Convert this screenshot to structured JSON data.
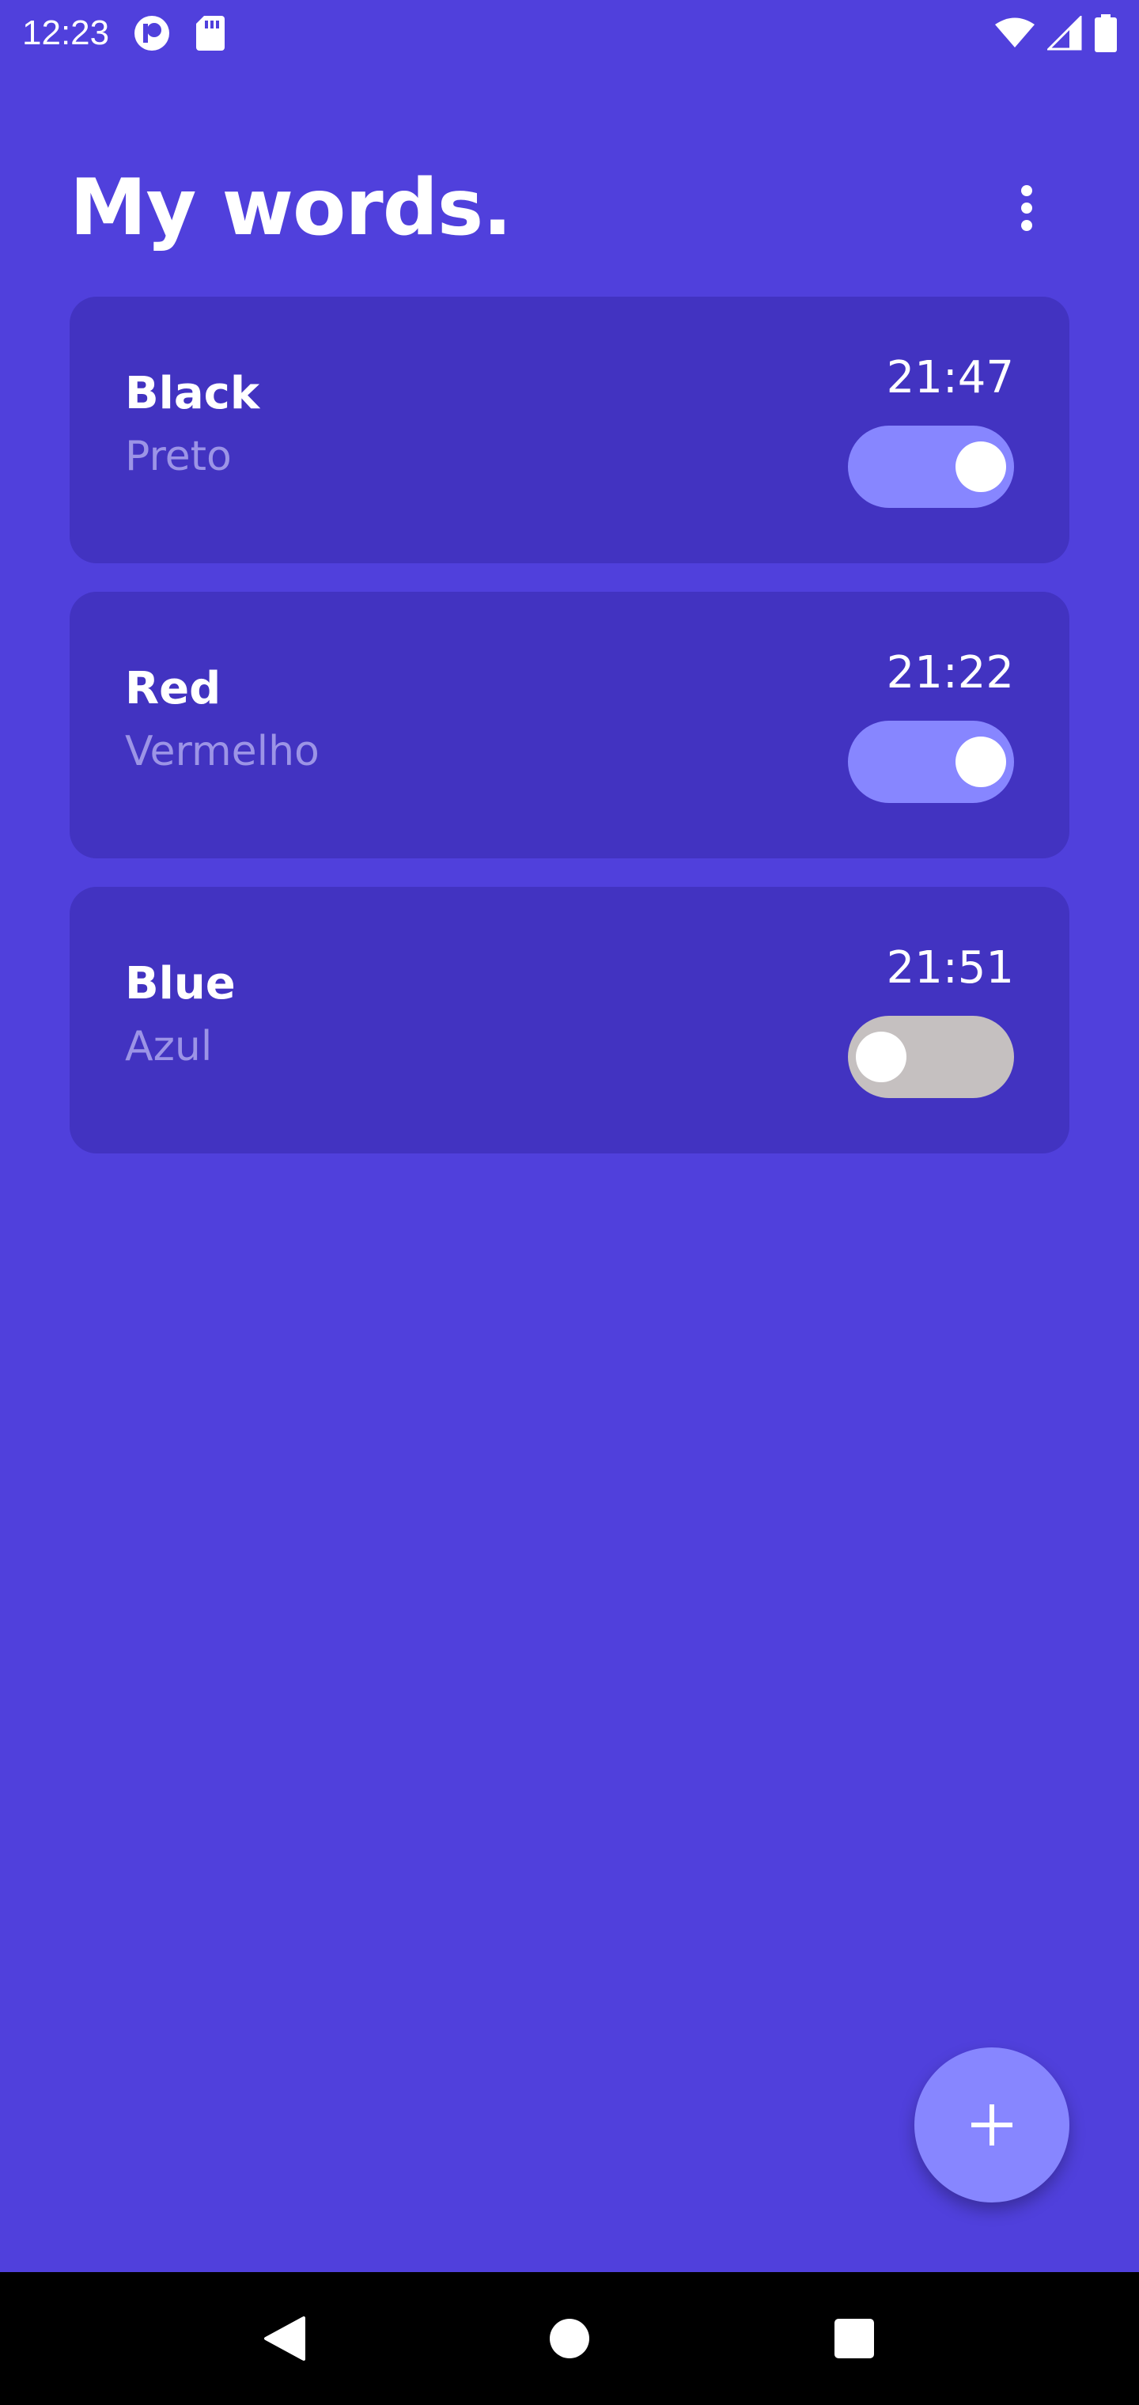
{
  "status_bar": {
    "time": "12:23",
    "icons_left": [
      "app-notification-icon",
      "sd-card-icon"
    ],
    "icons_right": [
      "wifi-icon",
      "cell-signal-icon",
      "battery-icon"
    ]
  },
  "header": {
    "title": "My words.",
    "menu_icon": "more-vert-icon"
  },
  "words": [
    {
      "word": "Black",
      "translation": "Preto",
      "time": "21:47",
      "enabled": true
    },
    {
      "word": "Red",
      "translation": "Vermelho",
      "time": "21:22",
      "enabled": true
    },
    {
      "word": "Blue",
      "translation": "Azul",
      "time": "21:51",
      "enabled": false
    }
  ],
  "fab": {
    "icon": "plus-icon"
  },
  "nav": {
    "icons": [
      "back-icon",
      "home-icon",
      "recents-icon"
    ]
  },
  "colors": {
    "background": "#5040DC",
    "card": "#4233C1",
    "accent": "#8786FF",
    "toggle_off": "#C5C0C0",
    "subtext": "#9C94E6"
  }
}
